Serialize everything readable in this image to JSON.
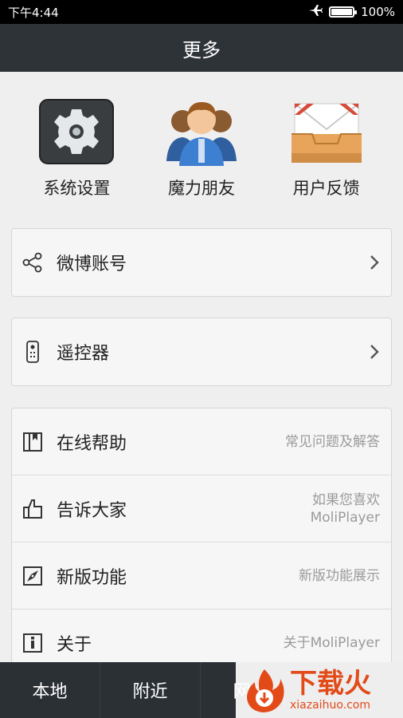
{
  "status_bar": {
    "time": "下午4:44",
    "battery_text": "100%",
    "battery_level": 1.0,
    "icons": [
      "airplane-icon",
      "battery-icon"
    ]
  },
  "header": {
    "title": "更多"
  },
  "shortcuts": [
    {
      "label": "系统设置",
      "icon": "gear-icon"
    },
    {
      "label": "魔力朋友",
      "icon": "friends-icon"
    },
    {
      "label": "用户反馈",
      "icon": "mail-tray-icon"
    }
  ],
  "card_weibo": {
    "label": "微博账号",
    "icon": "share-icon"
  },
  "card_remote": {
    "label": "遥控器",
    "icon": "remote-icon"
  },
  "card_info": [
    {
      "label": "在线帮助",
      "hint_1": "常见问题及解答",
      "hint_2": "",
      "icon": "book-icon"
    },
    {
      "label": "告诉大家",
      "hint_1": "如果您喜欢",
      "hint_2": "MoliPlayer",
      "icon": "thumbs-up-icon"
    },
    {
      "label": "新版功能",
      "hint_1": "新版功能展示",
      "hint_2": "",
      "icon": "compass-icon"
    },
    {
      "label": "关于",
      "hint_1": "关于MoliPlayer",
      "hint_2": "",
      "icon": "info-icon"
    }
  ],
  "bottom_nav": [
    {
      "label": "本地"
    },
    {
      "label": "附近"
    },
    {
      "label": "网络"
    }
  ],
  "watermark": {
    "text_cn": "下载火",
    "text_en": "xiazaihuo.com"
  },
  "colors": {
    "title_bar": "#2e3338",
    "bottom_nav": "#2b3035",
    "watermark": "#e24b18"
  }
}
